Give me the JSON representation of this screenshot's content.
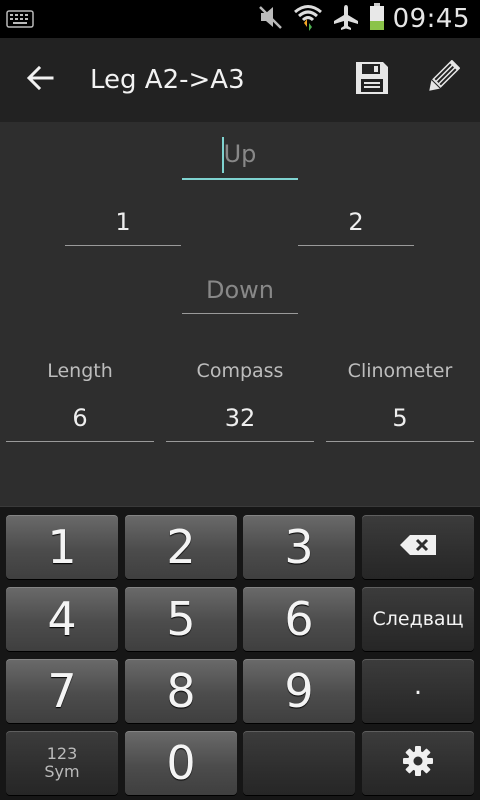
{
  "status_bar": {
    "time": "09:45",
    "icons": [
      "keyboard-icon",
      "mute-icon",
      "wifi-icon",
      "airplane-icon",
      "battery-icon"
    ],
    "battery_color": "#8bc34a"
  },
  "action_bar": {
    "title": "Leg A2->A3",
    "icons": [
      "back-arrow-icon",
      "save-icon",
      "edit-icon"
    ]
  },
  "form": {
    "up": {
      "value": "",
      "placeholder": "Up",
      "focused": true
    },
    "left": {
      "value": "1"
    },
    "right": {
      "value": "2"
    },
    "down": {
      "value": "",
      "placeholder": "Down"
    },
    "length": {
      "label": "Length",
      "value": "6"
    },
    "compass": {
      "label": "Compass",
      "value": "32"
    },
    "clinometer": {
      "label": "Clinometer",
      "value": "5"
    },
    "accent_color": "#7fd3d0"
  },
  "keyboard": {
    "digits": [
      "1",
      "2",
      "3",
      "4",
      "5",
      "6",
      "7",
      "8",
      "9",
      "0"
    ],
    "next_label": "Следващ",
    "dot_label": ".",
    "sym_line1": "123",
    "sym_line2": "Sym",
    "icons": [
      "backspace-icon",
      "gear-icon"
    ]
  }
}
